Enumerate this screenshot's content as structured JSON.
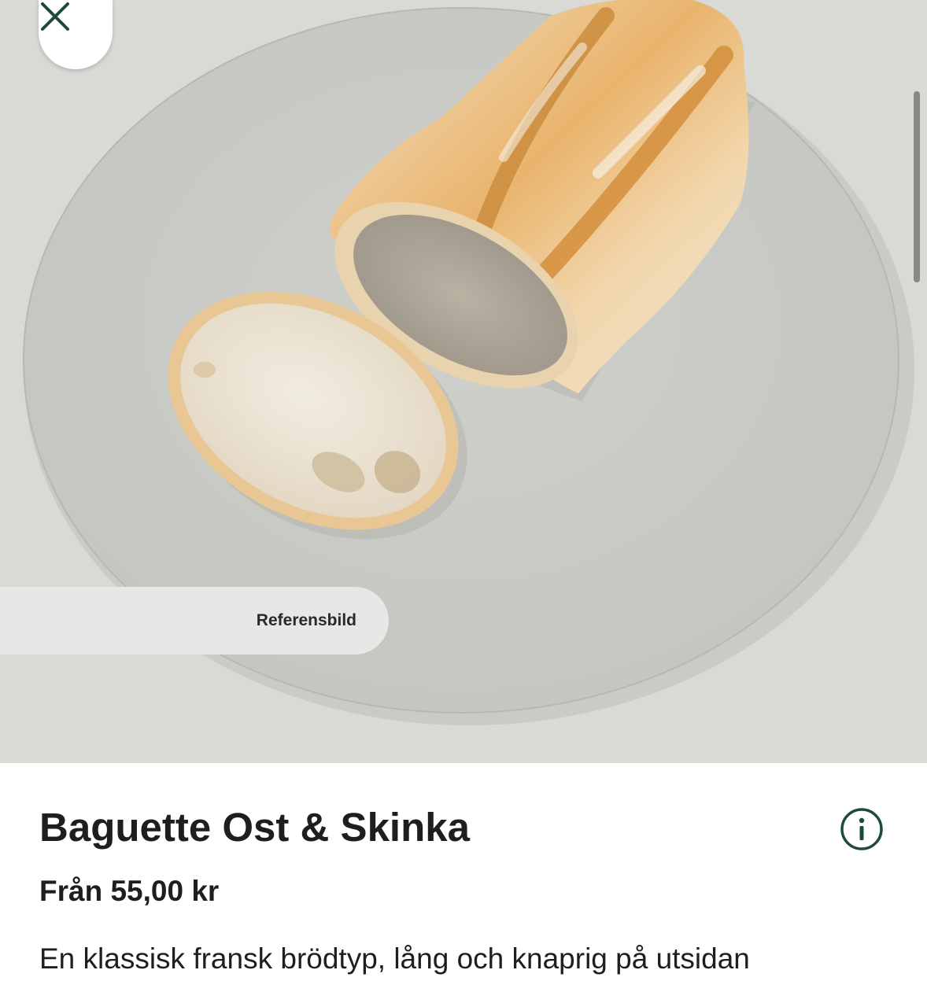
{
  "hero": {
    "image_alt": "baguette-on-plate",
    "reference_label": "Referensbild"
  },
  "controls": {
    "close_icon": "close-icon",
    "info_icon": "info-icon"
  },
  "product": {
    "title": "Baguette Ost & Skinka",
    "price": "Från 55,00 kr",
    "description": "En klassisk fransk brödtyp, lång och knaprig på utsidan"
  },
  "colors": {
    "accent": "#1f4a3a",
    "text": "#1e1e1e",
    "background": "#ffffff",
    "hero_bg": "#d9dad5"
  }
}
